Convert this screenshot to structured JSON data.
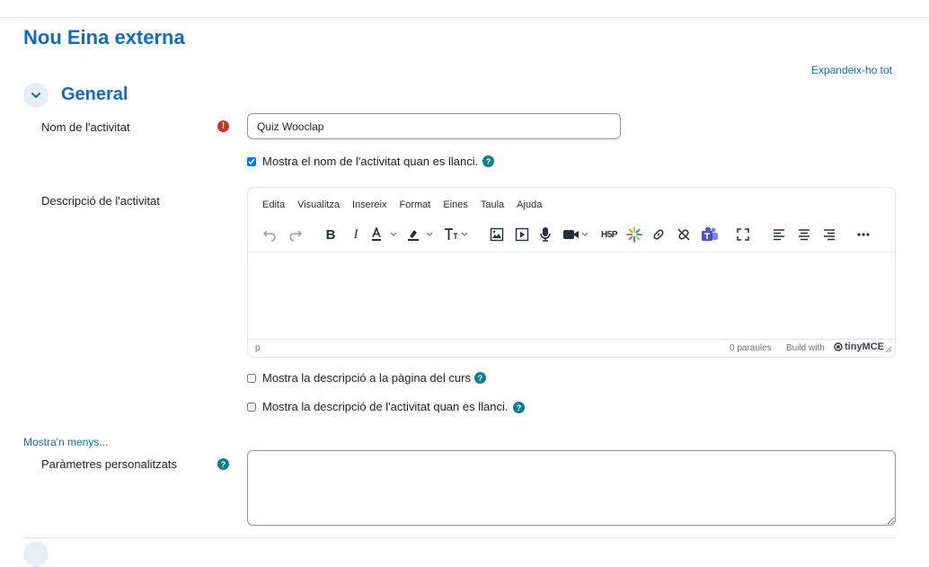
{
  "page": {
    "title": "Nou Eina externa"
  },
  "links": {
    "expand_all": "Expandeix-ho tot",
    "show_less": "Mostra'n menys..."
  },
  "section": {
    "title": "General"
  },
  "fields": {
    "name": {
      "label": "Nom de l'activitat",
      "value": "Quiz Wooclap",
      "required_icon": "exclamation-icon"
    },
    "show_name": {
      "label": "Mostra el nom de l'activitat quan es llanci.",
      "checked": true
    },
    "description": {
      "label": "Descripció de l'activitat"
    },
    "show_desc_course": {
      "label": "Mostra la descripció a la pàgina del curs",
      "checked": false
    },
    "show_desc_launch": {
      "label": "Mostra la descripció de l'activitat quan es llanci.",
      "checked": false
    },
    "custom_params": {
      "label": "Paràmetres personalitzats",
      "value": ""
    }
  },
  "editor": {
    "menu": [
      "Edita",
      "Visualitza",
      "Insereix",
      "Format",
      "Eines",
      "Taula",
      "Ajuda"
    ],
    "status": {
      "path": "p",
      "words": "0 paraules",
      "build": "Build with",
      "brand": "tinyMCE"
    }
  },
  "colors": {
    "accent": "#0f6cbf",
    "help": "#0f7e8a",
    "required": "#ca3120"
  }
}
